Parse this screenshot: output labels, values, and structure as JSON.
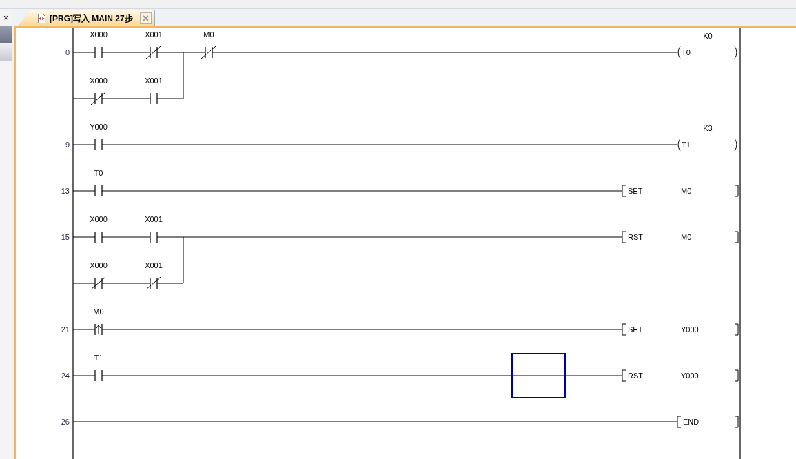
{
  "panel_close": "×",
  "tab": {
    "title": "[PRG]写入 MAIN 27步",
    "selected": true
  },
  "rungs": [
    {
      "step": "0",
      "cursor": false,
      "lines": [
        {
          "contacts": [
            {
              "device": "X000",
              "kind": "no"
            },
            {
              "device": "X001",
              "kind": "nc"
            },
            {
              "device": "M0",
              "kind": "nc"
            }
          ]
        },
        {
          "contacts": [
            {
              "device": "X000",
              "kind": "nc"
            },
            {
              "device": "X001",
              "kind": "no"
            }
          ]
        }
      ],
      "output": {
        "kind": "coil",
        "device": "T0",
        "constant": "K0"
      }
    },
    {
      "step": "9",
      "cursor": false,
      "lines": [
        {
          "contacts": [
            {
              "device": "Y000",
              "kind": "no"
            }
          ]
        }
      ],
      "output": {
        "kind": "coil",
        "device": "T1",
        "constant": "K3"
      }
    },
    {
      "step": "13",
      "cursor": false,
      "lines": [
        {
          "contacts": [
            {
              "device": "T0",
              "kind": "no"
            }
          ]
        }
      ],
      "output": {
        "kind": "instruction",
        "instruction": "SET",
        "device": "M0"
      }
    },
    {
      "step": "15",
      "cursor": false,
      "lines": [
        {
          "contacts": [
            {
              "device": "X000",
              "kind": "no"
            },
            {
              "device": "X001",
              "kind": "no"
            }
          ]
        },
        {
          "contacts": [
            {
              "device": "X000",
              "kind": "nc"
            },
            {
              "device": "X001",
              "kind": "nc"
            }
          ]
        }
      ],
      "output": {
        "kind": "instruction",
        "instruction": "RST",
        "device": "M0"
      }
    },
    {
      "step": "21",
      "cursor": false,
      "lines": [
        {
          "contacts": [
            {
              "device": "M0",
              "kind": "rising"
            }
          ]
        }
      ],
      "output": {
        "kind": "instruction",
        "instruction": "SET",
        "device": "Y000"
      }
    },
    {
      "step": "24",
      "cursor": true,
      "lines": [
        {
          "contacts": [
            {
              "device": "T1",
              "kind": "no"
            }
          ]
        }
      ],
      "output": {
        "kind": "instruction",
        "instruction": "RST",
        "device": "Y000"
      }
    },
    {
      "step": "26",
      "cursor": false,
      "output": {
        "kind": "end",
        "instruction": "END"
      }
    }
  ]
}
